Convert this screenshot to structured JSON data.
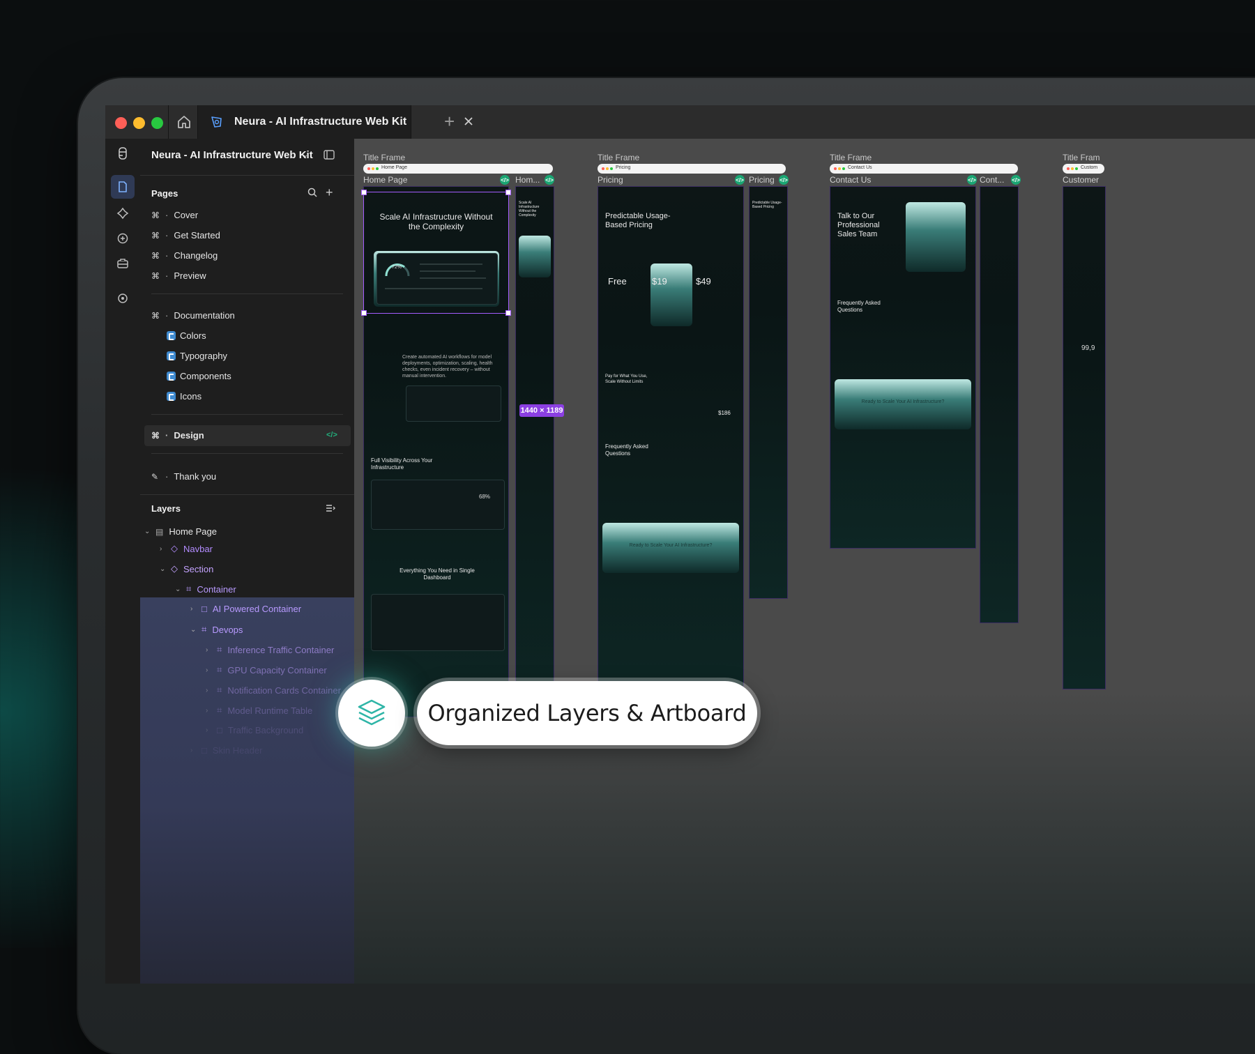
{
  "window": {
    "tab_title": "Neura - AI Infrastructure Web Kit",
    "traffic_colors": [
      "#ff5f57",
      "#febc2e",
      "#28c840"
    ]
  },
  "panel": {
    "project_name": "Neura - AI Infrastructure Web Kit",
    "pages_header": "Pages",
    "pages": [
      {
        "label": "Cover"
      },
      {
        "label": "Get Started"
      },
      {
        "label": "Changelog"
      },
      {
        "label": "Preview"
      }
    ],
    "documentation": {
      "label": "Documentation",
      "children": [
        "Colors",
        "Typography",
        "Components",
        "Icons"
      ]
    },
    "design_page": "Design",
    "thank_you_page": "Thank you",
    "layers_header": "Layers",
    "layers": [
      {
        "label": "Home Page"
      },
      {
        "label": "Navbar"
      },
      {
        "label": "Section"
      },
      {
        "label": "Container"
      },
      {
        "label": "AI Powered Container"
      },
      {
        "label": "Devops"
      },
      {
        "label": "Inference Traffic Container"
      },
      {
        "label": "GPU Capacity Container"
      },
      {
        "label": "Notification Cards Container"
      },
      {
        "label": "Model Runtime Table"
      },
      {
        "label": "Traffic Background"
      },
      {
        "label": "Skin Header"
      }
    ]
  },
  "canvas": {
    "frames": [
      {
        "label": "Title Frame",
        "bar": "Home Page",
        "page": "Home Page",
        "mobile": "Hom..."
      },
      {
        "label": "Title Frame",
        "bar": "Pricing",
        "page": "Pricing",
        "mobile": "Pricing"
      },
      {
        "label": "Title Frame",
        "bar": "Contact Us",
        "page": "Contact Us",
        "mobile": "Cont..."
      },
      {
        "label": "Title Fram",
        "bar": "Custom",
        "page": "Customer",
        "mobile": ""
      }
    ],
    "size_badge": "1440 × 1189",
    "home": {
      "hero": "Scale AI Infrastructure Without the Complexity",
      "gauge": "72%",
      "automate": "Create automated AI workflows for model deployments, optimization, scaling, health checks, even incident recovery – without manual intervention.",
      "visibility": "Full Visibility Across Your Infrastructure",
      "gauge2": "68%",
      "dashboard": "Everything You Need in Single Dashboard",
      "mobile_hero": "Scale AI Infrastructure Without the Complexity"
    },
    "pricing": {
      "hero": "Predictable Usage-Based Pricing",
      "tiers": [
        "Free",
        "$19",
        "$49"
      ],
      "usage": "Pay for What You Use, Scale Without Limits",
      "total": "$186",
      "faq": "Frequently Asked Questions",
      "cta": "Ready to Scale Your AI Infrastructure?",
      "mobile_hero": "Predictable Usage-Based Pricing"
    },
    "contact": {
      "hero": "Talk to Our Professional Sales Team",
      "faq": "Frequently Asked Questions",
      "cta": "Ready to Scale Your AI Infrastructure?"
    },
    "customer": {
      "stat": "99,9"
    }
  },
  "overlay": {
    "caption": "Organized Layers & Artboard",
    "icon": "layers-icon"
  }
}
